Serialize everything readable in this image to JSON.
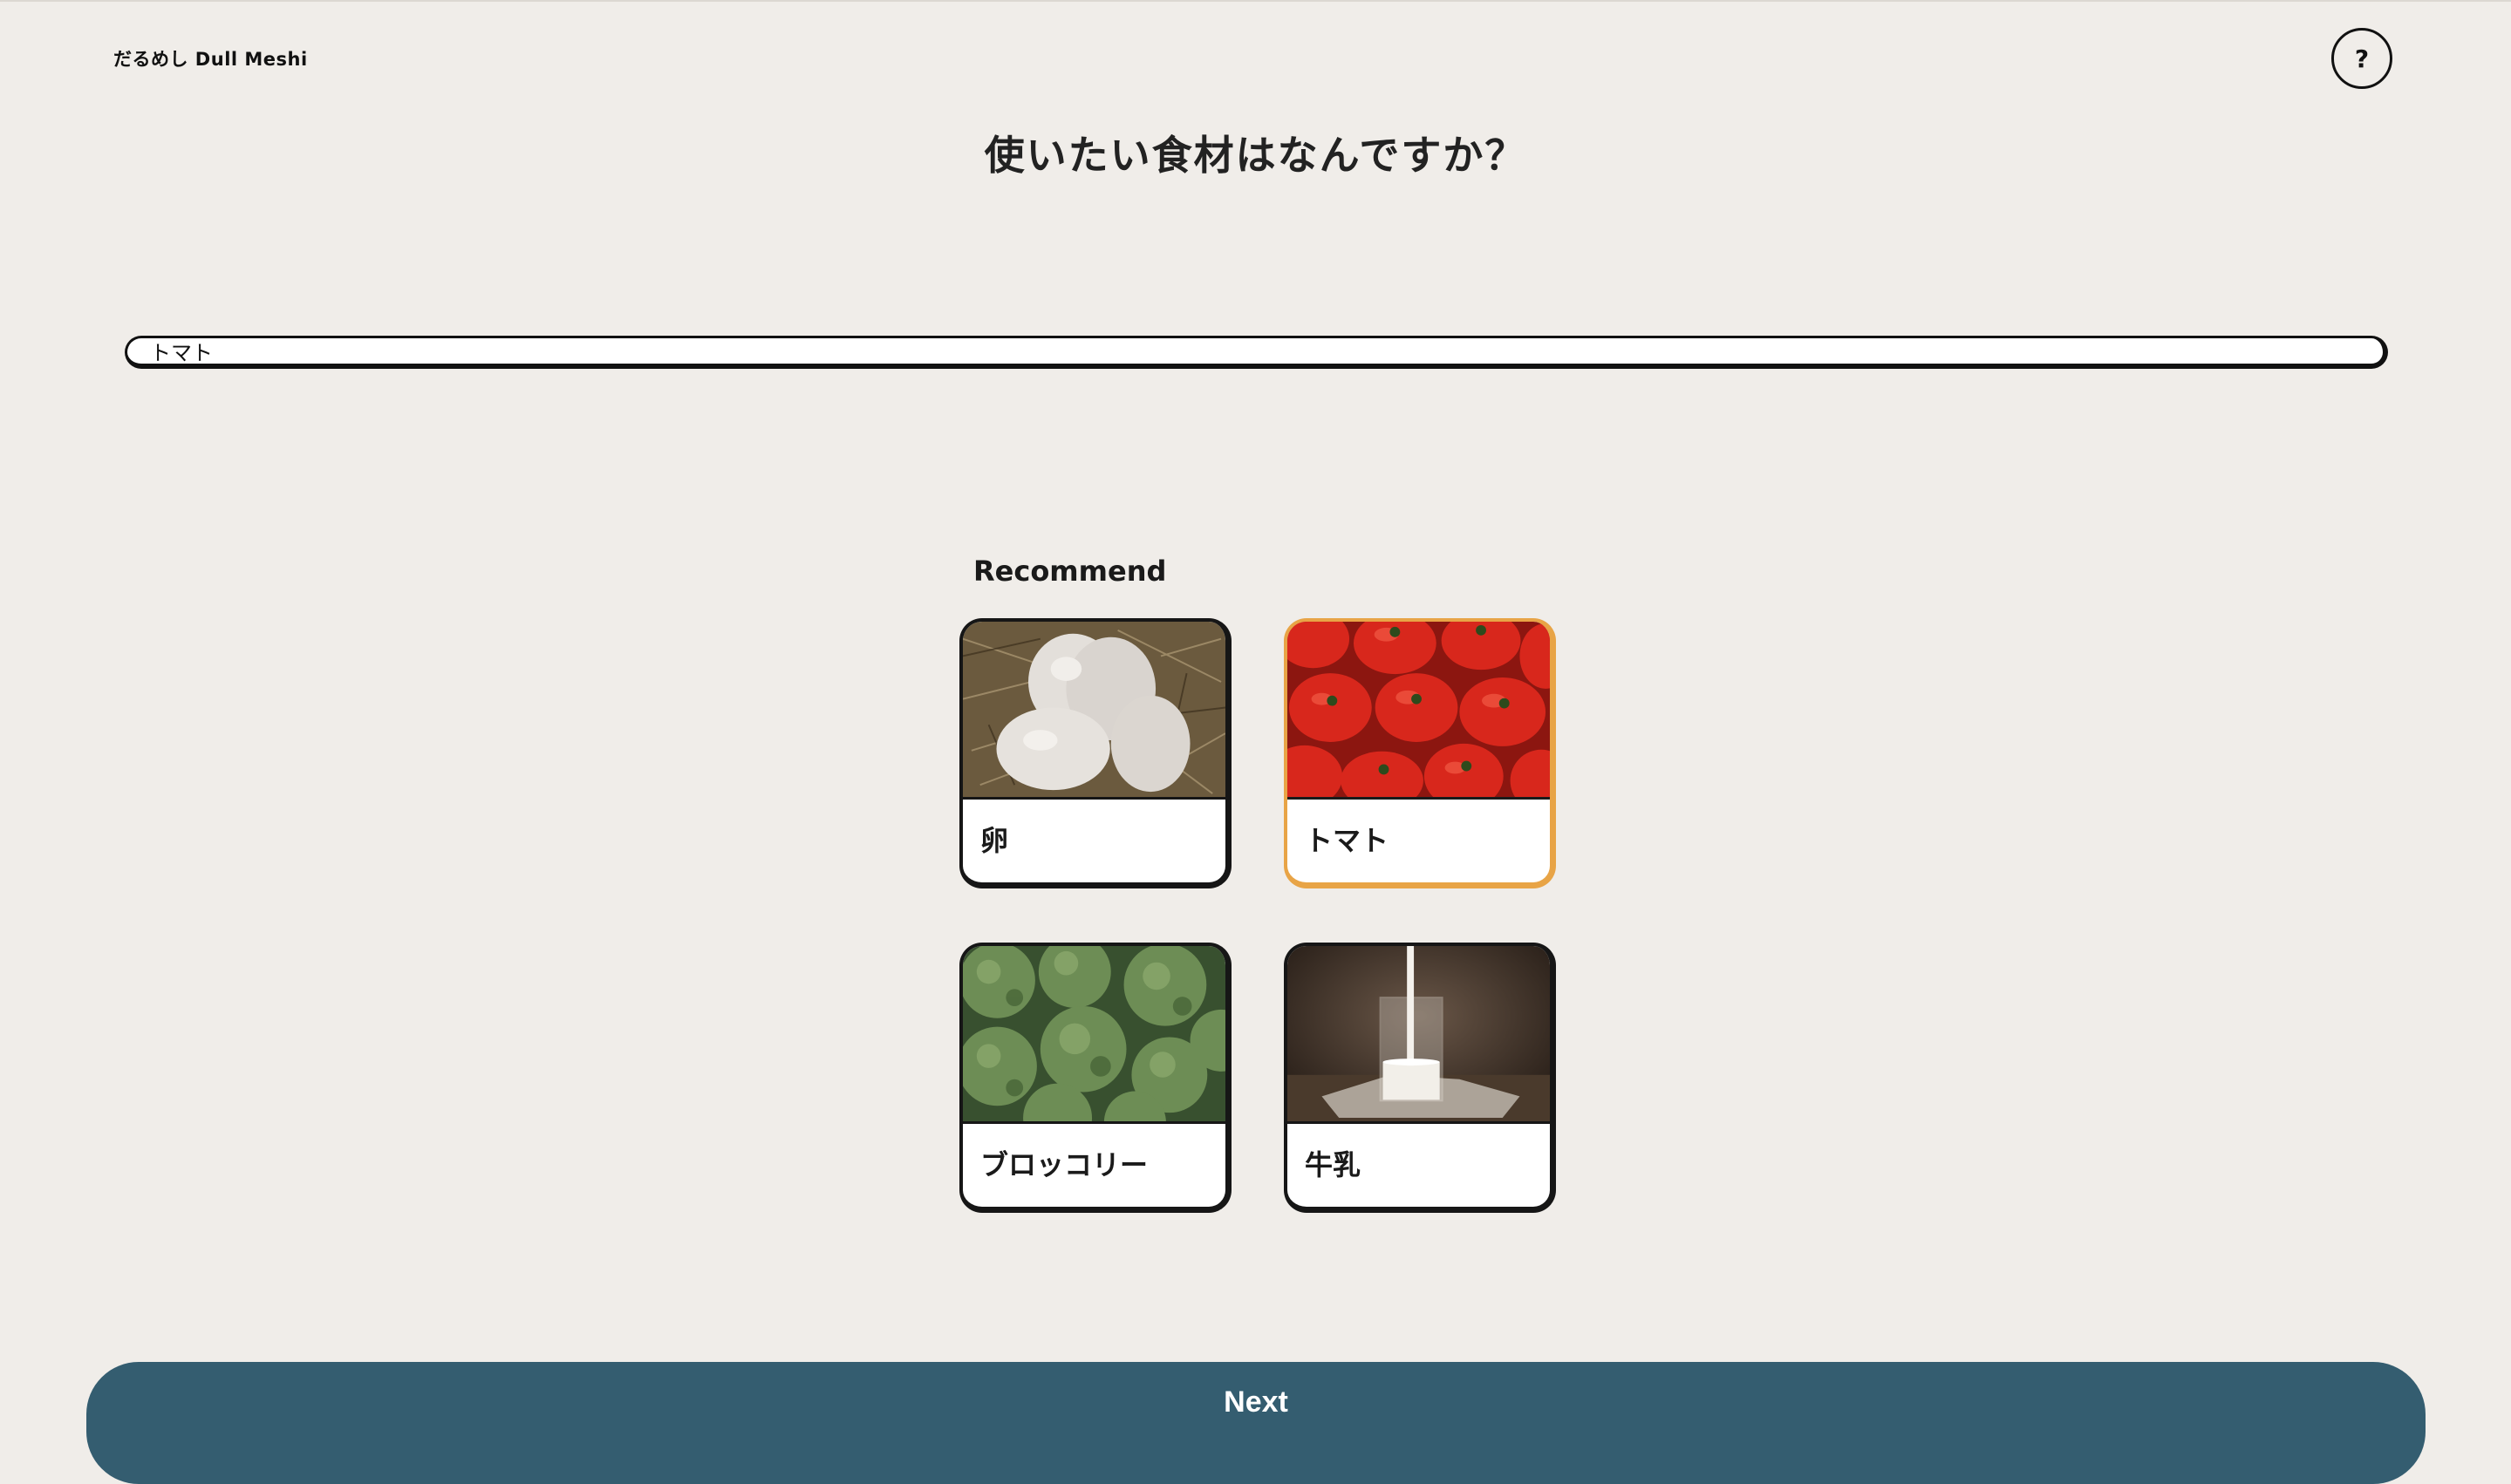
{
  "app": {
    "brand": "だるめし Dull Meshi",
    "help_label": "?"
  },
  "main": {
    "title": "使いたい食材はなんですか？",
    "search": {
      "value": "トマト"
    },
    "recommend": {
      "heading": "Recommend",
      "items": [
        {
          "label": "卵",
          "icon": "eggs-photo",
          "selected": false
        },
        {
          "label": "トマト",
          "icon": "tomatoes-photo",
          "selected": true
        },
        {
          "label": "ブロッコリー",
          "icon": "broccoli-photo",
          "selected": false
        },
        {
          "label": "牛乳",
          "icon": "milk-photo",
          "selected": false
        }
      ]
    }
  },
  "footer": {
    "next_label": "Next"
  },
  "colors": {
    "background": "#f0ede9",
    "primary_button": "#345d70",
    "selected_border": "#e8a446"
  }
}
